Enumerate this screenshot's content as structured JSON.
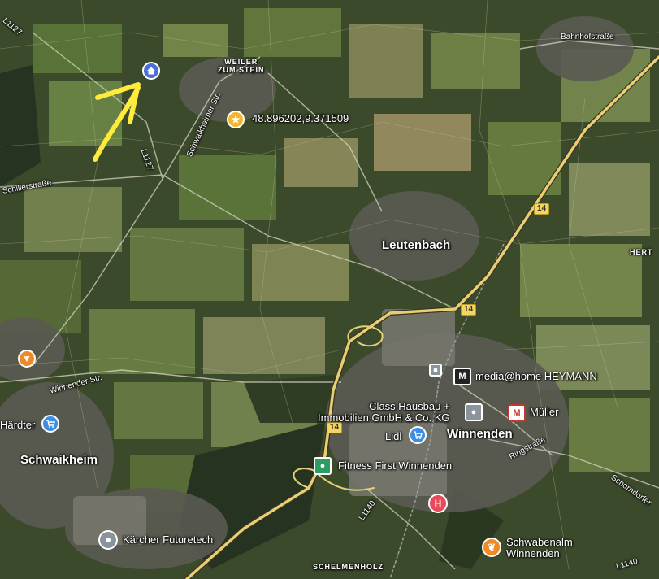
{
  "map": {
    "places": {
      "leutenbach": "Leutenbach",
      "winnenden": "Winnenden",
      "schwaikheim": "Schwaikheim",
      "weiler_line1": "WEILER",
      "weiler_line2": "ZUM STEIN",
      "schelmenholz": "SCHELMENHOLZ",
      "hert": "HERT"
    },
    "streets": {
      "l1127_top": "L1127",
      "l1127": "L1127",
      "schwaikheimer": "Schwaikheimer Str.",
      "schillerstrasse": "Schillerstraße",
      "bahnhofstrasse": "Bahnhofstraße",
      "winnender_str": "Winnender Str.",
      "ringstrasse": "Ringstraße",
      "schorndorfer": "Schorndorfer",
      "l1140_a": "L1140",
      "l1140_b": "L1140"
    },
    "roads": {
      "b14_a": "14",
      "b14_b": "14",
      "b14_c": "14"
    },
    "coordinate_label": "48.896202,9.371509",
    "pois": {
      "media_home": "media@home HEYMANN",
      "class_line1": "Class Hausbau +",
      "class_line2": "Immobilien GmbH & Co. KG",
      "mueller": "Müller",
      "lidl": "Lidl",
      "fitness_first": "Fitness First Winnenden",
      "kaercher": "Kärcher Futuretech",
      "schwabenalm_line1": "Schwabenalm",
      "schwabenalm_line2": "Winnenden",
      "haerdter": "Härdter"
    },
    "icons": {
      "home": "home-pin-icon",
      "star": "star-pin-icon",
      "shopping": "shopping-cart-pin-icon",
      "restaurant": "restaurant-pin-icon",
      "hospital": "hospital-pin-icon",
      "fitness": "fitness-pin-icon",
      "generic": "place-pin-icon",
      "train": "train-station-icon",
      "arrow": "yellow-arrow-annotation"
    },
    "colors": {
      "highway": "#e6cf74",
      "annotation": "#ffeb3b",
      "home_pin": "#4a6fd8",
      "star_pin": "#f2b632",
      "shop_pin": "#3f8de2",
      "food_pin": "#f08a24",
      "hospital_pin": "#e84a5a",
      "fitness_pin": "#2e9c63",
      "generic_pin": "#8a949c"
    }
  }
}
